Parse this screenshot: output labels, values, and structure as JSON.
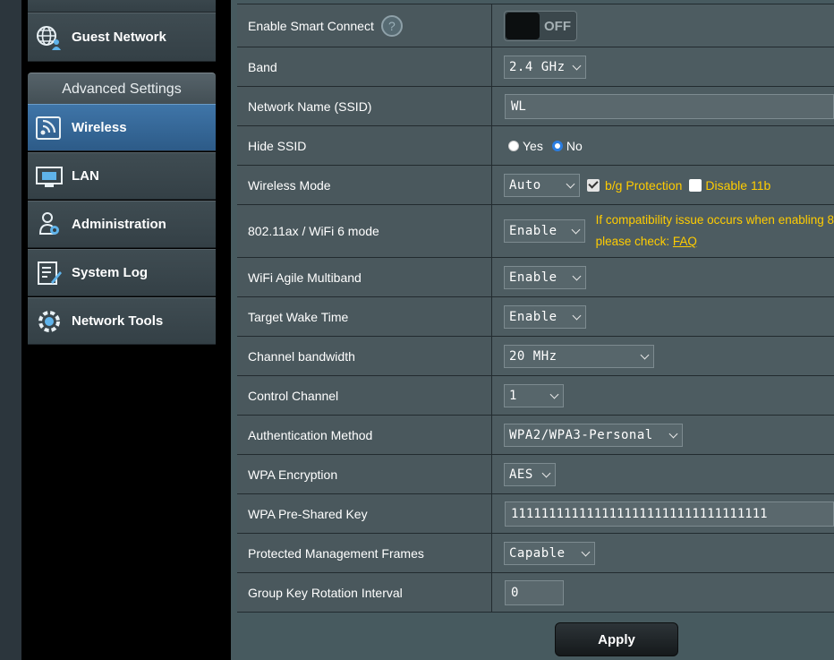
{
  "sidebar": {
    "guest_network": "Guest Network",
    "section_header": "Advanced Settings",
    "items": [
      {
        "label": "Wireless",
        "icon": "wireless-icon"
      },
      {
        "label": "LAN",
        "icon": "lan-icon"
      },
      {
        "label": "Administration",
        "icon": "administration-icon"
      },
      {
        "label": "System Log",
        "icon": "system-log-icon"
      },
      {
        "label": "Network Tools",
        "icon": "network-tools-icon"
      }
    ]
  },
  "settings": {
    "smart_connect": {
      "label": "Enable Smart Connect",
      "toggle": "OFF",
      "help": "?"
    },
    "band": {
      "label": "Band",
      "value": "2.4 GHz"
    },
    "ssid": {
      "label": "Network Name (SSID)",
      "value": "WL"
    },
    "hide_ssid": {
      "label": "Hide SSID",
      "yes": "Yes",
      "no": "No",
      "selected": "No"
    },
    "wireless_mode": {
      "label": "Wireless Mode",
      "value": "Auto",
      "bg_protection": "b/g Protection",
      "disable_11b": "Disable 11b"
    },
    "wifi6": {
      "label": "802.11ax / WiFi 6 mode",
      "value": "Enable",
      "warning_line1": "If compatibility issue occurs when enabling 8",
      "warning_line2": "please check: ",
      "faq": "FAQ"
    },
    "agile_multiband": {
      "label": "WiFi Agile Multiband",
      "value": "Enable"
    },
    "target_wake": {
      "label": "Target Wake Time",
      "value": "Enable"
    },
    "channel_bw": {
      "label": "Channel bandwidth",
      "value": "20 MHz"
    },
    "control_channel": {
      "label": "Control Channel",
      "value": "1"
    },
    "auth_method": {
      "label": "Authentication Method",
      "value": "WPA2/WPA3-Personal"
    },
    "wpa_encryption": {
      "label": "WPA Encryption",
      "value": "AES"
    },
    "psk": {
      "label": "WPA Pre-Shared Key",
      "value": "1111111111111111111111111111111111"
    },
    "pmf": {
      "label": "Protected Management Frames",
      "value": "Capable"
    },
    "group_key": {
      "label": "Group Key Rotation Interval",
      "value": "0"
    }
  },
  "apply_label": "Apply",
  "colors": {
    "accent_blue": "#2d5b88",
    "warning": "#ffcc00"
  }
}
